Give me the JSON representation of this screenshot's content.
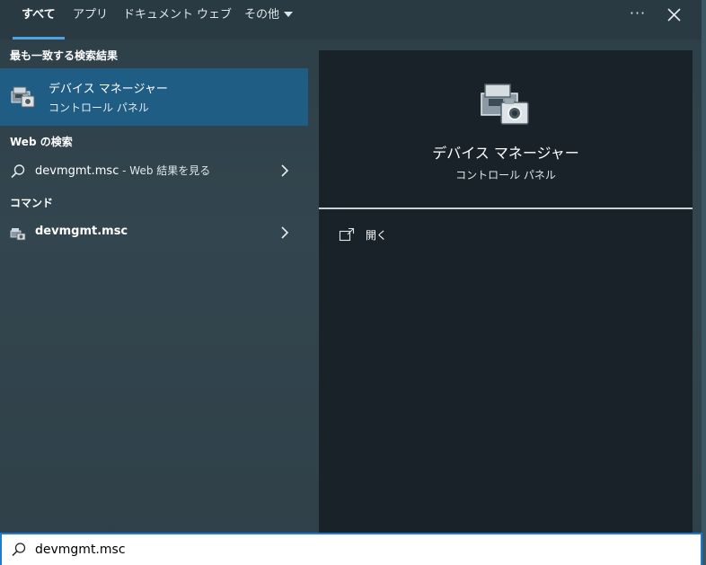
{
  "tabs": [
    {
      "label": "すべて",
      "active": true
    },
    {
      "label": "アプリ",
      "active": false
    },
    {
      "label": "ドキュメント",
      "active": false
    },
    {
      "label": "ウェブ",
      "active": false
    },
    {
      "label": "その他",
      "active": false,
      "dropdown": true
    }
  ],
  "toolbar": {
    "more_label": "···",
    "more_icon": "more-icon",
    "close_icon": "close-icon"
  },
  "sections": {
    "best_match_heading": "最も一致する検索結果",
    "web_heading": "Web の検索",
    "commands_heading": "コマンド"
  },
  "best_match": {
    "title": "デバイス マネージャー",
    "subtitle": "コントロール パネル",
    "icon": "device-manager-icon"
  },
  "web_result": {
    "query": "devmgmt.msc",
    "suffix": " - Web 結果を見る",
    "icon": "search-icon"
  },
  "command_result": {
    "label": "devmgmt.msc",
    "icon": "device-manager-icon"
  },
  "preview": {
    "title": "デバイス マネージャー",
    "subtitle": "コントロール パネル",
    "actions": [
      {
        "label": "開く",
        "icon": "open-icon"
      }
    ]
  },
  "search": {
    "value": "devmgmt.msc",
    "placeholder": ""
  },
  "colors": {
    "accent": "#4fa3e0",
    "selected_row": "#1f5d84",
    "preview_bg": "#182228",
    "search_border": "#1e7bd0"
  }
}
